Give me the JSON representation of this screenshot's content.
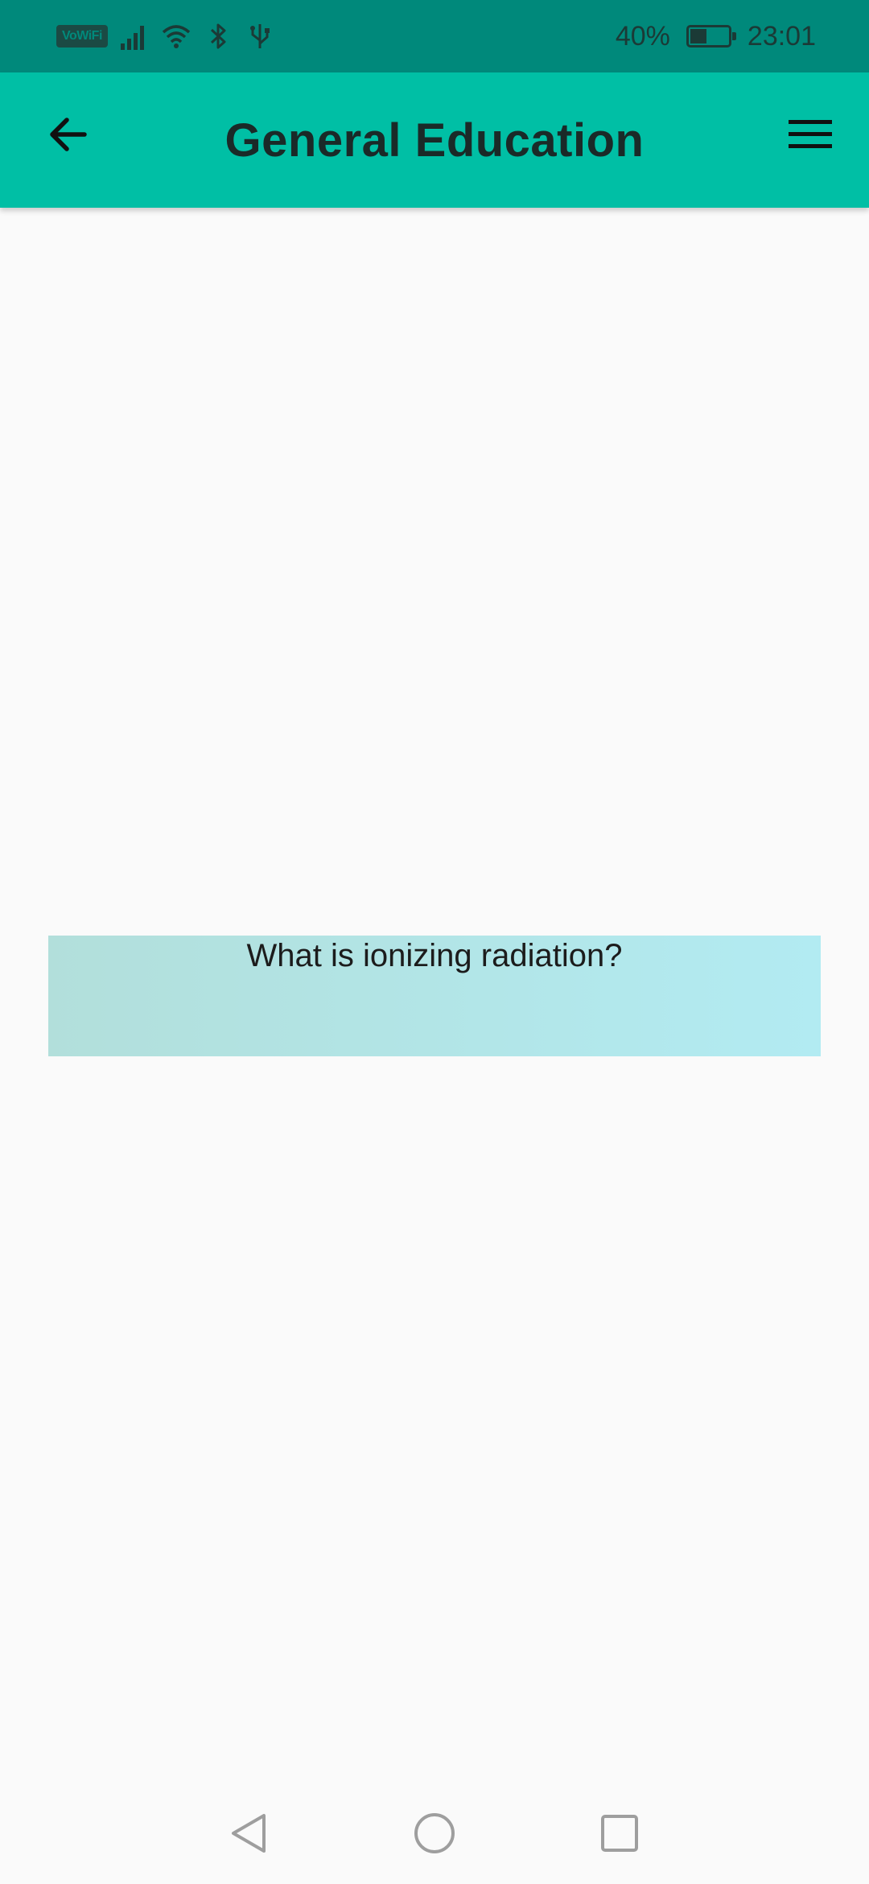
{
  "status_bar": {
    "network_badge": "VoWiFi",
    "battery_percent": "40%",
    "battery_level": 0.4,
    "time": "23:01",
    "icons": [
      "signal-icon",
      "wifi-icon",
      "bluetooth-icon",
      "usb-icon",
      "battery-charging-icon"
    ]
  },
  "app_bar": {
    "title": "General Education",
    "back_icon": "arrow-left-icon",
    "menu_icon": "hamburger-menu-icon",
    "color": "#00bfa5"
  },
  "main": {
    "question": "What is ionizing radiation?",
    "card_gradient": [
      "#b2dfdb",
      "#b2ebf2"
    ]
  },
  "nav_bar": {
    "items": [
      "back-triangle-icon",
      "home-circle-icon",
      "recents-square-icon"
    ]
  }
}
